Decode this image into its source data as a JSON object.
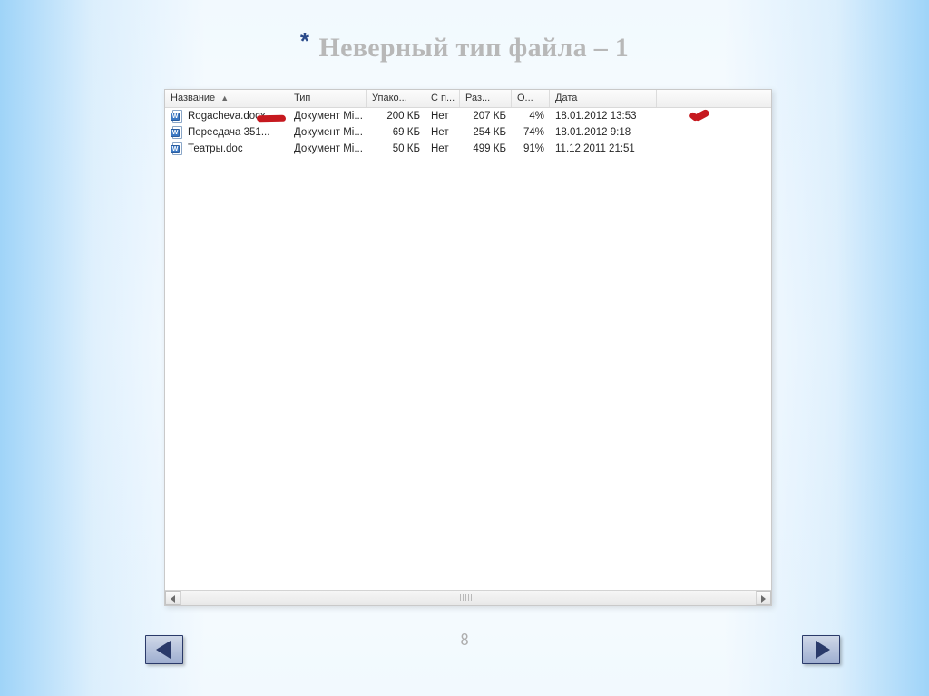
{
  "slide": {
    "asterisk": "*",
    "title": "Неверный тип файла – 1",
    "page_number": "8"
  },
  "columns": {
    "name": "Название",
    "type": "Тип",
    "packed": "Упако...",
    "sp": "С п...",
    "size": "Раз...",
    "pct": "О...",
    "date": "Дата"
  },
  "rows": [
    {
      "name": "Rogacheva.docx",
      "type": "Документ Mi...",
      "packed": "200 КБ",
      "sp": "Нет",
      "size": "207 КБ",
      "pct": "4%",
      "date": "18.01.2012 13:53"
    },
    {
      "name": "Пересдача 351...",
      "type": "Документ Mi...",
      "packed": "69 КБ",
      "sp": "Нет",
      "size": "254 КБ",
      "pct": "74%",
      "date": "18.01.2012 9:18"
    },
    {
      "name": "Театры.doc",
      "type": "Документ Mi...",
      "packed": "50 КБ",
      "sp": "Нет",
      "size": "499 КБ",
      "pct": "91%",
      "date": "11.12.2011 21:51"
    }
  ]
}
